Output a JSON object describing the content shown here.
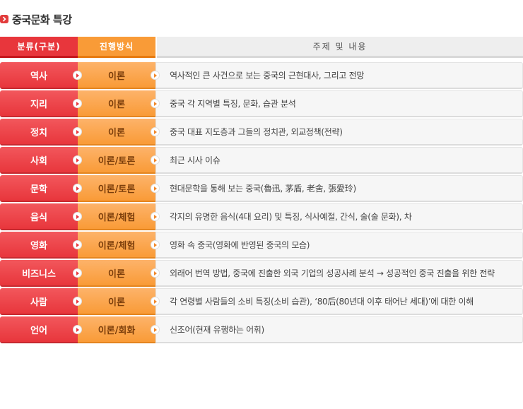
{
  "title": "중국문화 특강",
  "header": {
    "category": "분류(구분)",
    "method": "진행방식",
    "topic": "주제 및 내용"
  },
  "rows": [
    {
      "category": "역사",
      "method": "이론",
      "topic": "역사적인 큰 사건으로 보는 중국의 근현대사, 그리고 전망"
    },
    {
      "category": "지리",
      "method": "이론",
      "topic": "중국 각 지역별 특징, 문화, 습관 분석"
    },
    {
      "category": "정치",
      "method": "이론",
      "topic": "중국 대표 지도층과 그들의 정치관, 외교정책(전략)"
    },
    {
      "category": "사회",
      "method": "이론/토론",
      "topic": "최근 시사 이슈"
    },
    {
      "category": "문학",
      "method": "이론/토론",
      "topic": "현대문학을 통해 보는 중국(魯迅, 茅盾, 老舍, 張愛玲)"
    },
    {
      "category": "음식",
      "method": "이론/체험",
      "topic": "각지의 유명한 음식(4대 요리) 및 특징, 식사예절, 간식, 술(술 문화), 차"
    },
    {
      "category": "영화",
      "method": "이론/체험",
      "topic": "영화 속 중국(영화에 반영된 중국의 모습)"
    },
    {
      "category": "비즈니스",
      "method": "이론",
      "topic": "외래어 번역 방법, 중국에 진출한 외국 기업의 성공사례 분석 → 성공적인 중국 진출을 위한 전략"
    },
    {
      "category": "사람",
      "method": "이론",
      "topic": "각 연령별 사람들의 소비 특징(소비 습관), ‘80后(80년대 이후 태어난 세대)’에 대한 이해"
    },
    {
      "category": "언어",
      "method": "이론/회화",
      "topic": "신조어(현재 유행하는 어휘)"
    }
  ],
  "colors": {
    "category": "#e8363c",
    "method": "#f99b37",
    "topic_bg": "#f6f6f6"
  },
  "icons": {
    "title": "chevron-right-icon",
    "row_arrow": "play-arrow-icon"
  }
}
